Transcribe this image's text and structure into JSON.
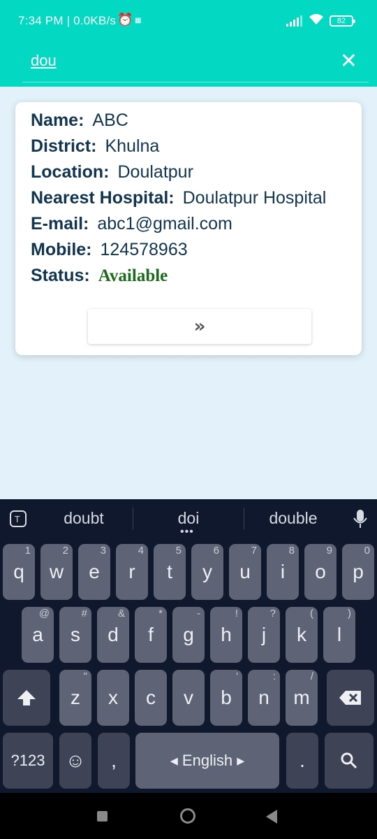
{
  "status_bar": {
    "time_speed": "7:34 PM | 0.0KB/s",
    "alarm_icon": "alarm-icon",
    "battery": "82"
  },
  "search": {
    "query": "dou",
    "clear_icon": "close-icon"
  },
  "result": {
    "rows": [
      {
        "label": "Name:",
        "value": "ABC"
      },
      {
        "label": "District:",
        "value": "Khulna"
      },
      {
        "label": "Location:",
        "value": "Doulatpur"
      },
      {
        "label": "Nearest Hospital:",
        "value": "Doulatpur Hospital"
      },
      {
        "label": "E-mail:",
        "value": "abc1@gmail.com"
      },
      {
        "label": "Mobile:",
        "value": "124578963"
      }
    ],
    "status_label": "Status:",
    "status_value": "Available",
    "status_color": "#1c6b1c",
    "next_icon": "double-chevron-right-icon",
    "next_glyph": "»"
  },
  "keyboard": {
    "suggestions": [
      "doubt",
      "doi",
      "double"
    ],
    "row1": [
      {
        "k": "q",
        "h": "1"
      },
      {
        "k": "w",
        "h": "2"
      },
      {
        "k": "e",
        "h": "3"
      },
      {
        "k": "r",
        "h": "4"
      },
      {
        "k": "t",
        "h": "5"
      },
      {
        "k": "y",
        "h": "6"
      },
      {
        "k": "u",
        "h": "7"
      },
      {
        "k": "i",
        "h": "8"
      },
      {
        "k": "o",
        "h": "9"
      },
      {
        "k": "p",
        "h": "0"
      }
    ],
    "row2": [
      {
        "k": "a",
        "h": "@"
      },
      {
        "k": "s",
        "h": "#"
      },
      {
        "k": "d",
        "h": "&"
      },
      {
        "k": "f",
        "h": "*"
      },
      {
        "k": "g",
        "h": "-"
      },
      {
        "k": "h",
        "h": "!"
      },
      {
        "k": "j",
        "h": "?"
      },
      {
        "k": "k",
        "h": "("
      },
      {
        "k": "l",
        "h": ")"
      }
    ],
    "row3": [
      {
        "k": "z",
        "h": "\""
      },
      {
        "k": "x",
        "h": ""
      },
      {
        "k": "c",
        "h": ""
      },
      {
        "k": "v",
        "h": ""
      },
      {
        "k": "b",
        "h": "'"
      },
      {
        "k": "n",
        "h": ":"
      },
      {
        "k": "m",
        "h": "/"
      }
    ],
    "symbols_label": "?123",
    "comma_label": ",",
    "space_label": "◂ English ▸",
    "period_label": ".",
    "accent_color": "#5e6475"
  }
}
